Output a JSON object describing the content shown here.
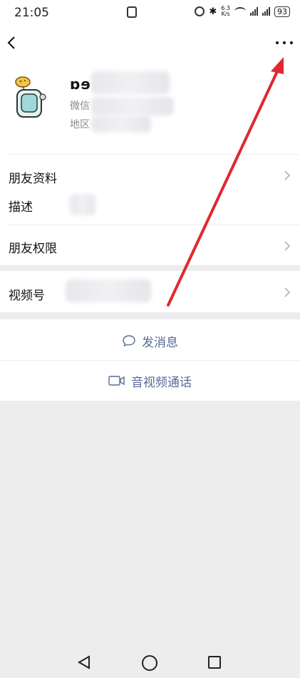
{
  "status_bar": {
    "time": "21:05",
    "network_speed_value": "6.3",
    "network_speed_unit": "K/s",
    "battery": "93"
  },
  "profile": {
    "nickname_visible": "ɒɘ",
    "wechat_id_label": "微信",
    "region_label": "地区"
  },
  "rows": {
    "friend_info": "朋友资料",
    "description": "描述",
    "friend_permissions": "朋友权限",
    "channels": "视频号"
  },
  "actions": {
    "send_message": "发消息",
    "video_call": "音视频通话"
  },
  "colors": {
    "link_blue": "#576b95",
    "annotation_red": "#e0282e",
    "background_gray": "#ededed"
  }
}
